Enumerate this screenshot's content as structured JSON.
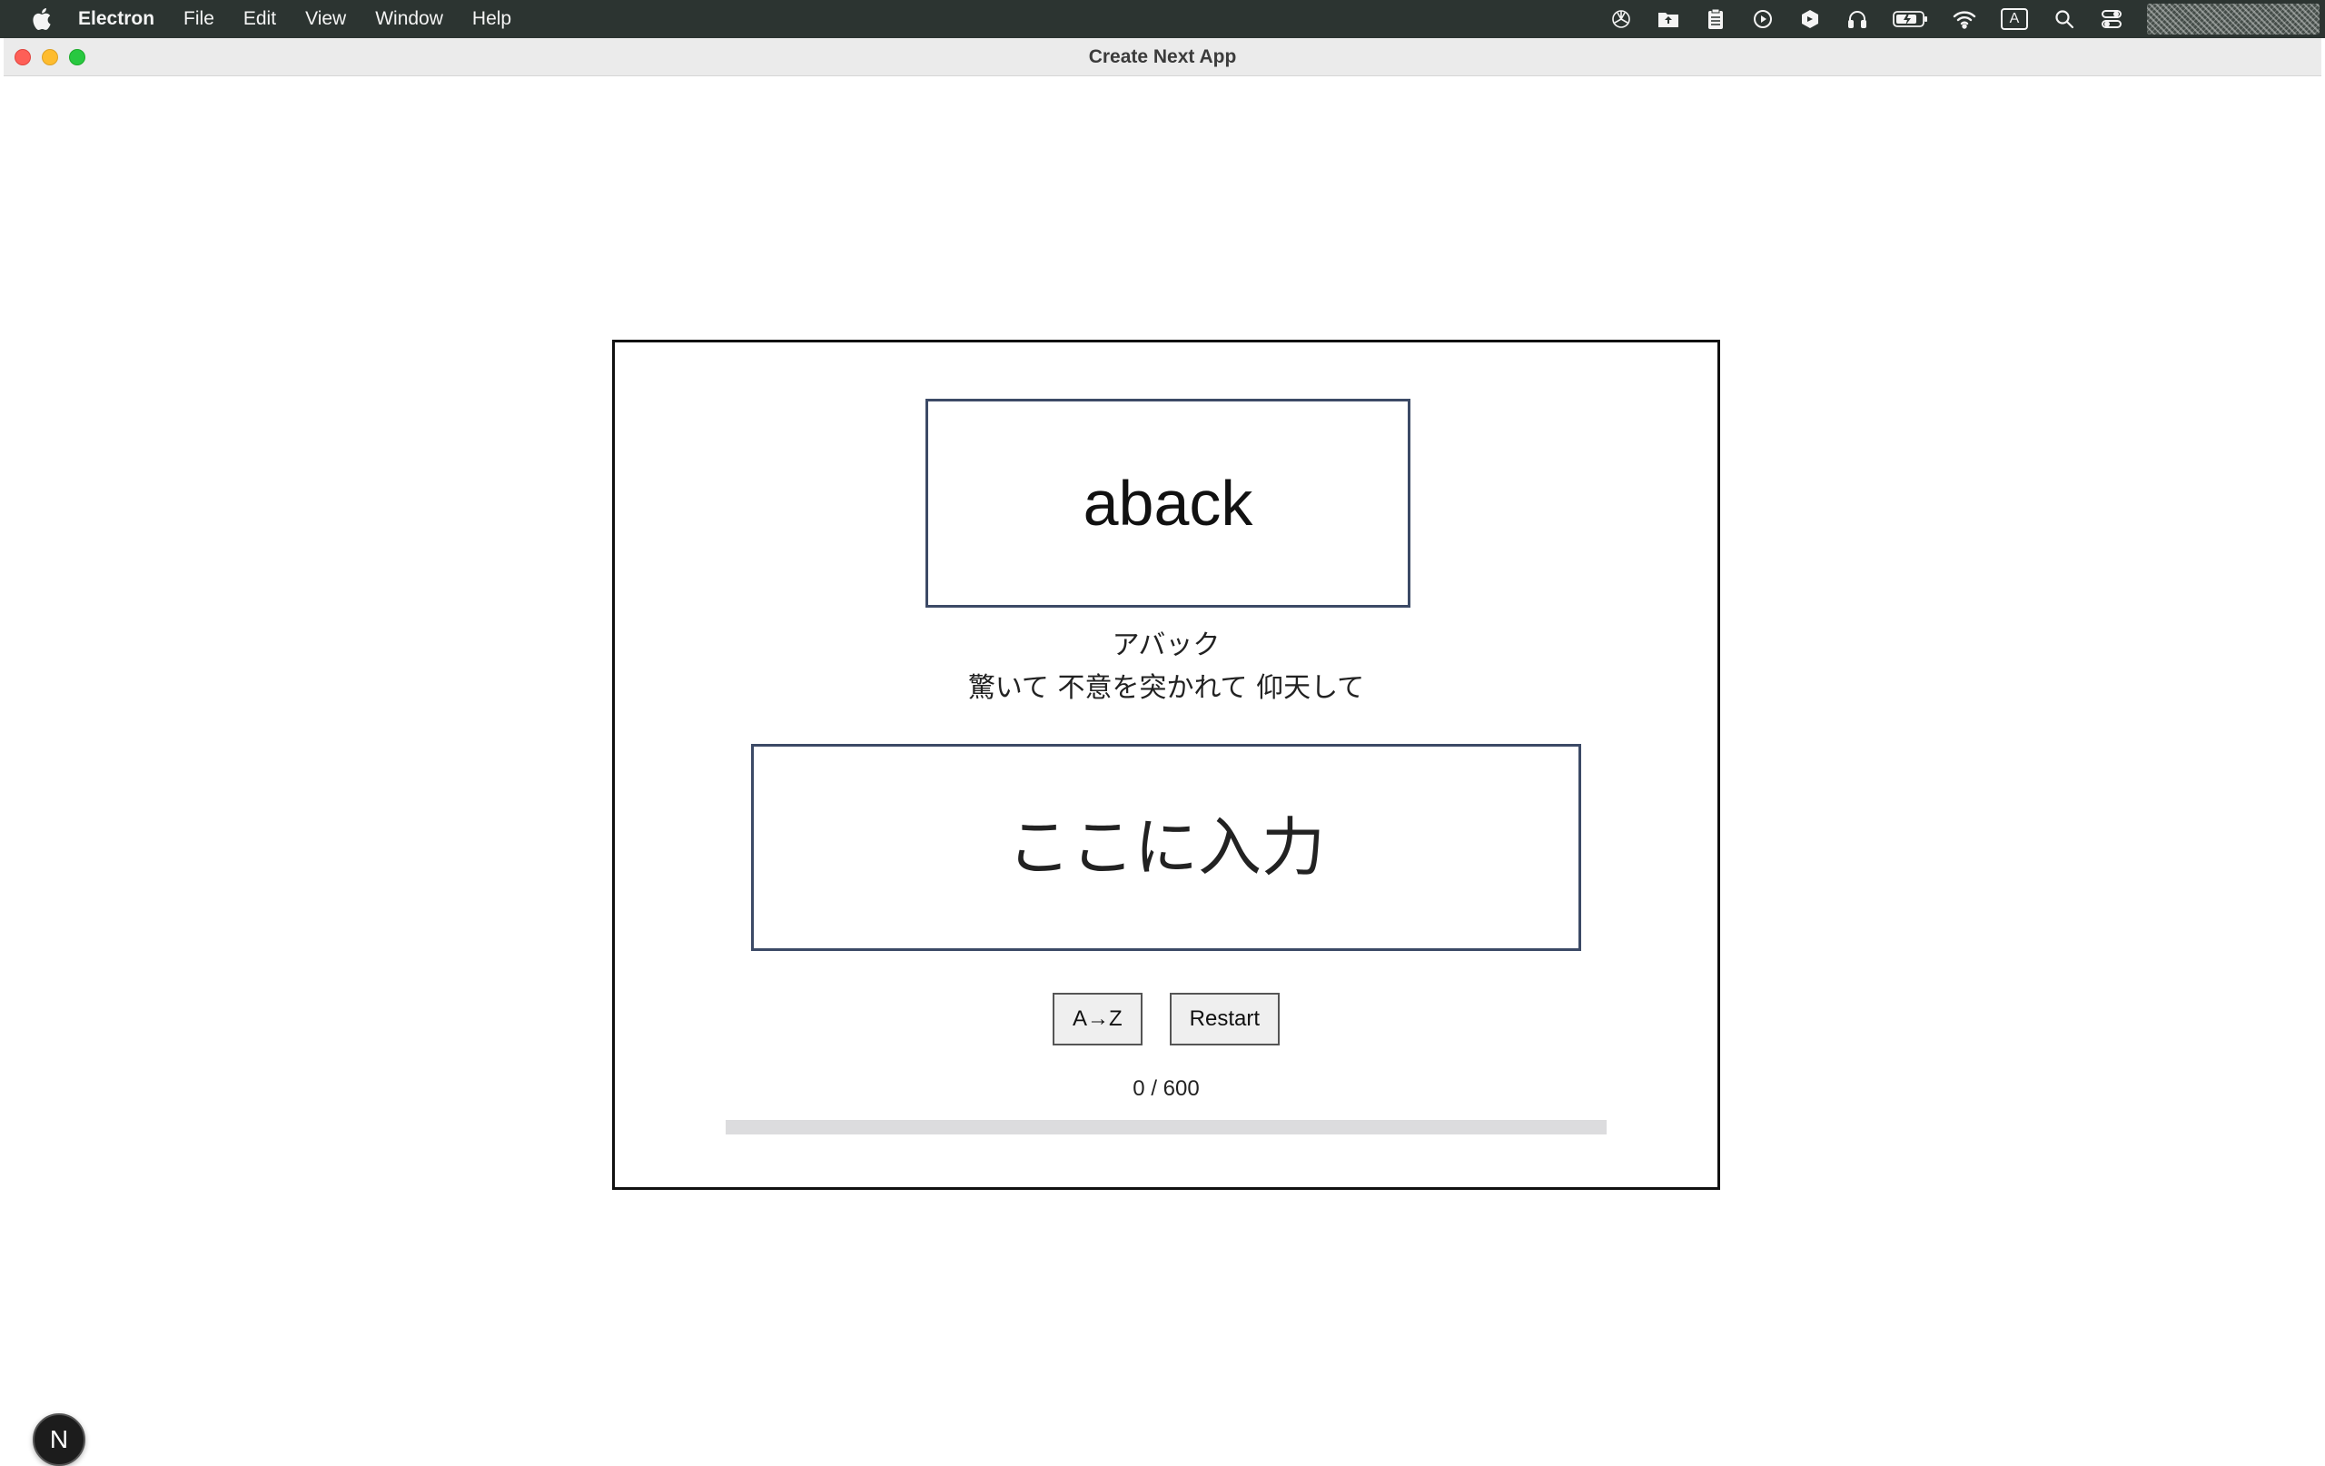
{
  "menubar": {
    "app_name": "Electron",
    "items": [
      "File",
      "Edit",
      "View",
      "Window",
      "Help"
    ],
    "status_icons": [
      "openai-icon",
      "upload-folder-icon",
      "clipboard-icon",
      "play-circle-icon",
      "cube-icon",
      "headphones-icon",
      "battery-icon",
      "wifi-icon",
      "input-source-icon",
      "search-icon",
      "control-center-icon"
    ],
    "input_source_label": "A"
  },
  "window": {
    "title": "Create Next App"
  },
  "quiz": {
    "word": "aback",
    "reading": "アバック",
    "meaning": "驚いて 不意を突かれて 仰天して",
    "answer_placeholder": "ここに入力",
    "answer_value": "",
    "sort_button_label": "A→Z",
    "restart_button_label": "Restart",
    "progress_text": "0 / 600",
    "progress_fraction": 0
  },
  "dev_indicator": {
    "label": "N"
  },
  "colors": {
    "menubar_bg": "#2c3431",
    "box_border": "#3c4a66",
    "progress_track": "#dcdcde"
  }
}
